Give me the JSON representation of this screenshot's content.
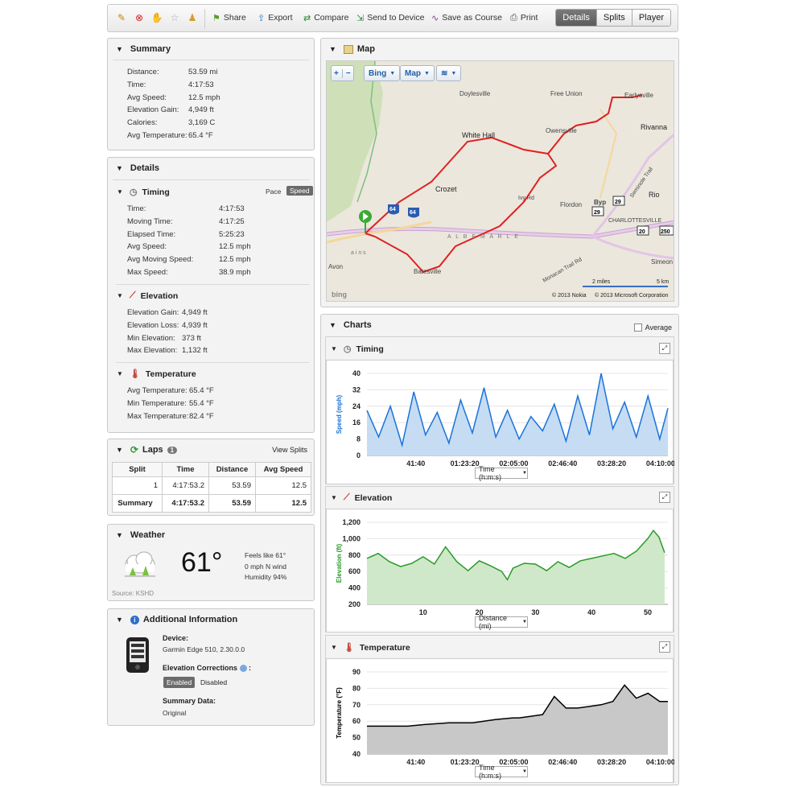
{
  "toolbar": {
    "actions": [
      "Share",
      "Export",
      "Compare",
      "Send to Device",
      "Save as Course",
      "Print"
    ],
    "views": [
      "Details",
      "Splits",
      "Player"
    ],
    "active_view": "Details"
  },
  "summary": {
    "title": "Summary",
    "rows": [
      {
        "label": "Distance:",
        "value": "53.59 mi"
      },
      {
        "label": "Time:",
        "value": "4:17:53"
      },
      {
        "label": "Avg Speed:",
        "value": "12.5 mph"
      },
      {
        "label": "Elevation Gain:",
        "value": "4,949 ft"
      },
      {
        "label": "Calories:",
        "value": "3,169 C"
      },
      {
        "label": "Avg Temperature:",
        "value": "65.4 °F"
      }
    ]
  },
  "details": {
    "title": "Details",
    "timing": {
      "title": "Timing",
      "toggle": [
        "Pace",
        "Speed"
      ],
      "rows": [
        {
          "label": "Time:",
          "value": "4:17:53"
        },
        {
          "label": "Moving Time:",
          "value": "4:17:25"
        },
        {
          "label": "Elapsed Time:",
          "value": "5:25:23"
        },
        {
          "label": "Avg Speed:",
          "value": "12.5 mph"
        },
        {
          "label": "Avg Moving Speed:",
          "value": "12.5 mph"
        },
        {
          "label": "Max Speed:",
          "value": "38.9 mph"
        }
      ]
    },
    "elevation": {
      "title": "Elevation",
      "rows": [
        {
          "label": "Elevation Gain:",
          "value": "4,949 ft"
        },
        {
          "label": "Elevation Loss:",
          "value": "4,939 ft"
        },
        {
          "label": "Min Elevation:",
          "value": "373 ft"
        },
        {
          "label": "Max Elevation:",
          "value": "1,132 ft"
        }
      ]
    },
    "temperature": {
      "title": "Temperature",
      "rows": [
        {
          "label": "Avg Temperature:",
          "value": "65.4 °F"
        },
        {
          "label": "Min Temperature:",
          "value": "55.4 °F"
        },
        {
          "label": "Max Temperature:",
          "value": "82.4 °F"
        }
      ]
    }
  },
  "laps": {
    "title": "Laps",
    "count": "1",
    "view_splits": "View Splits",
    "headers": [
      "Split",
      "Time",
      "Distance",
      "Avg Speed"
    ],
    "row": [
      "1",
      "4:17:53.2",
      "53.59",
      "12.5"
    ],
    "summary": [
      "Summary",
      "4:17:53.2",
      "53.59",
      "12.5"
    ]
  },
  "weather": {
    "title": "Weather",
    "temp": "61°",
    "feels": "Feels like 61°",
    "wind": "0 mph N wind",
    "humidity": "Humidity 94%",
    "source": "Source: KSHD"
  },
  "additional": {
    "title": "Additional Information",
    "device_label": "Device:",
    "device_value": "Garmin Edge 510, 2.30.0.0",
    "elev_corr_label": "Elevation Corrections",
    "enabled": "Enabled",
    "disabled": "Disabled",
    "summary_label": "Summary Data:",
    "summary_value": "Original"
  },
  "map": {
    "title": "Map",
    "provider": "Bing",
    "type": "Map",
    "places": [
      "Doylesville",
      "Free Union",
      "Earlysville",
      "White Hall",
      "Owensville",
      "Rivanna",
      "Crozet",
      "Ivy Rd",
      "Flordon",
      "Byp",
      "Rio",
      "CHARLOTTESVILLE",
      "Batesville",
      "Avon",
      "Simeon",
      "Seminole Trail",
      "Monacan Trail Rd",
      "A L B E M A R L E",
      "a i n s"
    ],
    "shields": [
      "64",
      "64",
      "29",
      "29",
      "20",
      "250"
    ],
    "scale_mi": "2 miles",
    "scale_km": "5 km",
    "copy1": "© 2013 Nokia",
    "copy2": "© 2013 Microsoft Corporation",
    "bing": "bing"
  },
  "charts": {
    "title": "Charts",
    "average": "Average",
    "timing_title": "Timing",
    "elevation_title": "Elevation",
    "temperature_title": "Temperature",
    "time_dd": "Time (h:m:s)",
    "dist_dd": "Distance (mi)"
  },
  "chart_data": [
    {
      "type": "area",
      "title": "Timing",
      "ylabel": "Speed (mph)",
      "xlabel": "Time (h:m:s)",
      "ylim": [
        0,
        40
      ],
      "yticks": [
        "0",
        "8",
        "16",
        "24",
        "32",
        "40"
      ],
      "xticks": [
        "41:40",
        "01:23:20",
        "02:05:00",
        "02:46:40",
        "03:28:20",
        "04:10:00"
      ],
      "x": [
        0,
        10,
        20,
        30,
        40,
        50,
        60,
        70,
        80,
        90,
        100,
        110,
        120,
        130,
        140,
        150,
        160,
        170,
        180,
        190,
        200,
        210,
        220,
        230,
        240,
        250,
        257
      ],
      "y": [
        22,
        9,
        24,
        5,
        31,
        10,
        21,
        6,
        27,
        11,
        33,
        9,
        22,
        8,
        19,
        12,
        25,
        7,
        29,
        10,
        40,
        13,
        26,
        9,
        29,
        8,
        23
      ],
      "color": "#1a73d9",
      "fill": "#c5dcf3"
    },
    {
      "type": "area",
      "title": "Elevation",
      "ylabel": "Elevation (ft)",
      "xlabel": "Distance (mi)",
      "ylim": [
        200,
        1200
      ],
      "yticks": [
        "200",
        "400",
        "600",
        "800",
        "1,000",
        "1,200"
      ],
      "xticks": [
        "10",
        "20",
        "30",
        "40",
        "50"
      ],
      "x": [
        0,
        2,
        4,
        6,
        8,
        10,
        12,
        14,
        16,
        18,
        20,
        22,
        24,
        25,
        26,
        28,
        30,
        32,
        34,
        36,
        38,
        40,
        42,
        44,
        46,
        48,
        50,
        51,
        52,
        53
      ],
      "y": [
        760,
        820,
        720,
        660,
        700,
        780,
        690,
        900,
        720,
        610,
        730,
        670,
        600,
        500,
        640,
        700,
        690,
        610,
        720,
        650,
        730,
        760,
        790,
        820,
        760,
        850,
        1000,
        1100,
        1020,
        830
      ],
      "color": "#2a9a2a",
      "fill": "#cfe8c9"
    },
    {
      "type": "area",
      "title": "Temperature",
      "ylabel": "Temperature (°F)",
      "xlabel": "Time (h:m:s)",
      "ylim": [
        40,
        90
      ],
      "yticks": [
        "40",
        "50",
        "60",
        "70",
        "80",
        "90"
      ],
      "xticks": [
        "41:40",
        "01:23:20",
        "02:05:00",
        "02:46:40",
        "03:28:20",
        "04:10:00"
      ],
      "x": [
        0,
        20,
        35,
        50,
        70,
        90,
        110,
        125,
        130,
        140,
        150,
        160,
        170,
        180,
        190,
        200,
        210,
        220,
        230,
        240,
        250,
        257
      ],
      "y": [
        57,
        57,
        57,
        58,
        59,
        59,
        61,
        62,
        62,
        63,
        64,
        75,
        68,
        68,
        69,
        70,
        72,
        82,
        74,
        77,
        72,
        72
      ],
      "color": "#000000",
      "fill": "#c8c8c8"
    }
  ]
}
